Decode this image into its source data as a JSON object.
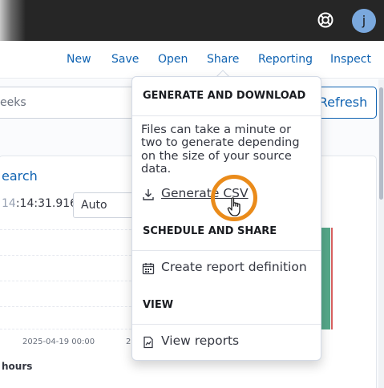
{
  "topbar": {
    "help_icon": "lifebuoy-icon",
    "avatar_initial": "j",
    "avatar_color": "#7aa8dd"
  },
  "nav": {
    "new": "New",
    "save": "Save",
    "open": "Open",
    "share": "Share",
    "reporting": "Reporting",
    "inspect": "Inspect"
  },
  "query": {
    "time_fragment": "eeks",
    "refresh_label": "Refresh"
  },
  "panel": {
    "search_link": "earch",
    "time_prefix": "14",
    "time_rest": ":14:31.916",
    "interval_value": "Auto",
    "x_tick_1": "2025-04-19 00:00",
    "x_tick_2": "2",
    "axis_label_fragment": "hours"
  },
  "popover": {
    "generate_title": "GENERATE AND DOWNLOAD",
    "description": "Files can take a minute or two to generate depending on the size of your source data.",
    "generate_csv": "Generate CSV",
    "schedule_title": "SCHEDULE AND SHARE",
    "create_report": "Create report definition",
    "view_title": "VIEW",
    "view_reports": "View reports"
  },
  "colors": {
    "accent": "#1063b2",
    "highlight": "#ea8b1a",
    "bar_green": "#55a88a",
    "bar_red": "#d86060"
  },
  "icons": {
    "download": "download-icon",
    "calendar": "calendar-icon",
    "report": "report-icon",
    "cursor": "pointer-hand-icon"
  }
}
